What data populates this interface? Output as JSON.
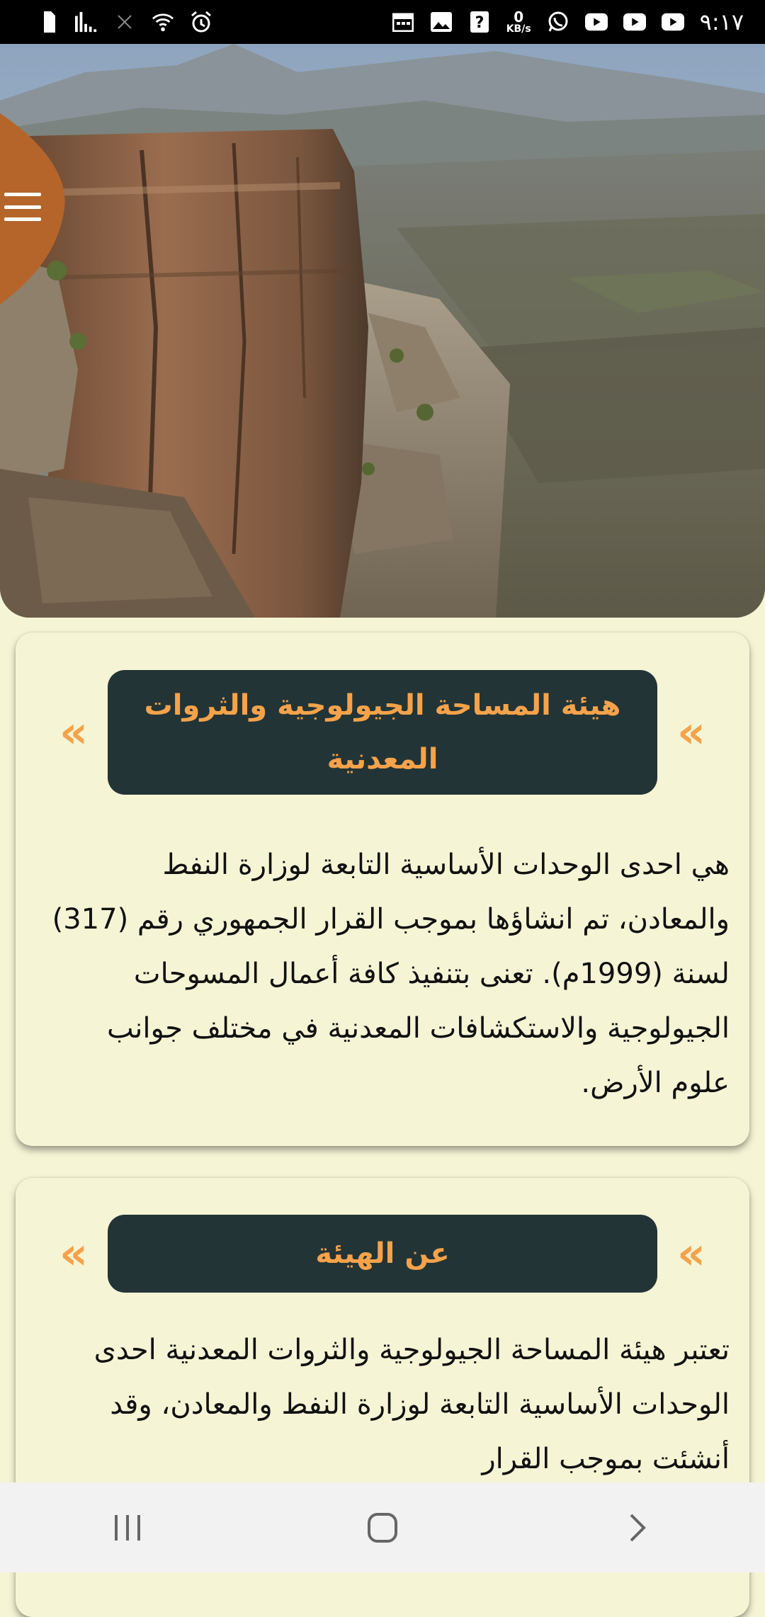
{
  "status_bar": {
    "time": "٩:١٧",
    "net_speed_value": "0",
    "net_speed_unit": "KB/s",
    "left_icons": [
      "sim-icon",
      "signal-icon",
      "data-off-icon",
      "wifi-icon",
      "alarm-icon"
    ],
    "right_icons": [
      "calendar-icon",
      "gallery-icon",
      "unknown-app-icon",
      "whatsapp-icon",
      "youtube-icon",
      "youtube-icon",
      "youtube-icon"
    ]
  },
  "hero": {
    "image": "mountain-cliff-landscape"
  },
  "cards": [
    {
      "title": "هيئة المساحة الجيولوجية والثروات المعدنية",
      "body": "هي احدى الوحدات الأساسية التابعة لوزارة النفط والمعادن، تم انشاؤها بموجب القرار الجمهوري رقم (317) لسنة (1999م). تعنى بتنفيذ كافة أعمال المسوحات الجيولوجية والاستكشافات المعدنية في مختلف جوانب علوم الأرض."
    },
    {
      "title": "عن الهيئة",
      "body": "تعتبر هيئة المساحة الجيولوجية والثروات المعدنية احدى الوحدات الأساسية التابعة لوزارة النفط والمعادن، وقد أنشئت بموجب القرار"
    }
  ],
  "chevron_glyph": "«",
  "colors": {
    "accent": "#f5a24a",
    "title_bg": "#233436",
    "page_bg": "#f5f5d6",
    "menu_blob": "#b5652a"
  },
  "nav_bar": {
    "buttons": [
      "recent-apps-icon",
      "home-icon",
      "back-icon"
    ]
  }
}
